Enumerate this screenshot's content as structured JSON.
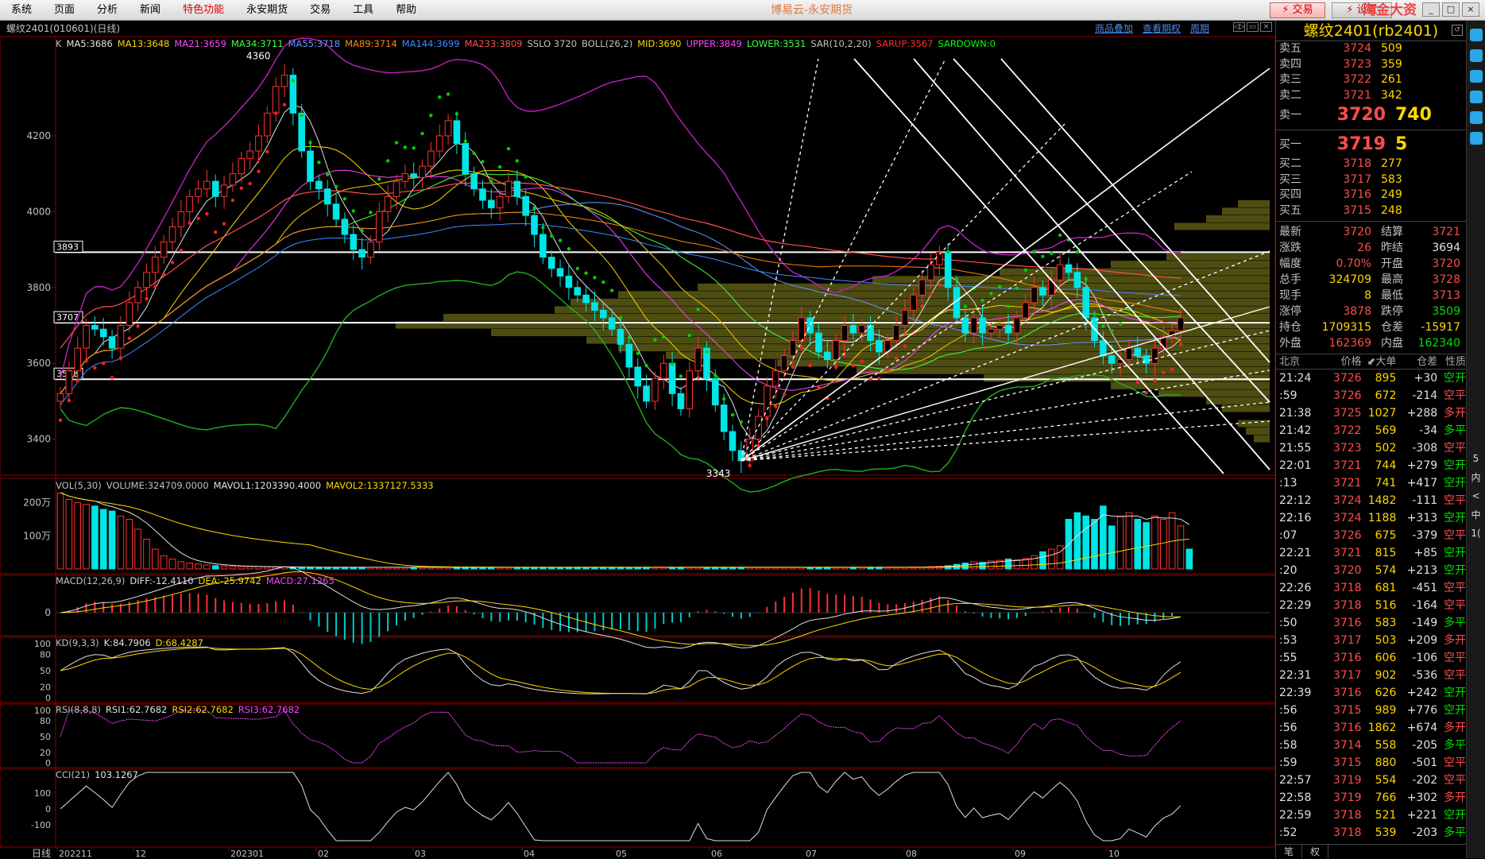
{
  "menu": [
    "系统",
    "页面",
    "分析",
    "新闻",
    "特色功能",
    "永安期货",
    "交易",
    "工具",
    "帮助"
  ],
  "menu_active": "特色功能",
  "app_title": "博易云-永安期货",
  "trade_button": "⚡ 交易",
  "trade_button2": "⚡ 设置",
  "watermark": "淘金大资5etz.com",
  "win_controls": [
    "_",
    "□",
    "×"
  ],
  "chart_header": {
    "symbol": "螺纹2401(010601)(日线)",
    "links": [
      "商品叠加",
      "查看期权",
      "周期"
    ],
    "icons": [
      "◁▷",
      "▭",
      "×"
    ]
  },
  "main_legend": [
    {
      "text": "K",
      "color": "#c0c0c0"
    },
    {
      "text": "MA5:3686",
      "color": "#e0e0e0"
    },
    {
      "text": "MA13:3648",
      "color": "#ffd700"
    },
    {
      "text": "MA21:3659",
      "color": "#ff44ff"
    },
    {
      "text": "MA34:3711",
      "color": "#44ff44"
    },
    {
      "text": "MA55:3718",
      "color": "#6699ff"
    },
    {
      "text": "MA89:3714",
      "color": "#ff8800"
    },
    {
      "text": "MA144:3699",
      "color": "#4488ff"
    },
    {
      "text": "MA233:3809",
      "color": "#ff5050"
    },
    {
      "text": "SSLO 3720",
      "color": "#c0c0c0"
    },
    {
      "text": "BOLL(26,2)",
      "color": "#c0c0c0"
    },
    {
      "text": "MID:3690",
      "color": "#ffd700"
    },
    {
      "text": "UPPER:3849",
      "color": "#ff44ff"
    },
    {
      "text": "LOWER:3531",
      "color": "#44ff44"
    },
    {
      "text": "SAR(10,2,20)",
      "color": "#c0c0c0"
    },
    {
      "text": "SARUP:3567",
      "color": "#ff3030"
    },
    {
      "text": "SARDOWN:0",
      "color": "#00ff00"
    }
  ],
  "vol_legend": [
    {
      "text": "VOL(5,30)",
      "color": "#c0c0c0"
    },
    {
      "text": "VOLUME:324709.0000",
      "color": "#c0c0c0"
    },
    {
      "text": "MAVOL1:1203390.4000",
      "color": "#e0e0e0"
    },
    {
      "text": "MAVOL2:1337127.5333",
      "color": "#ffd700"
    }
  ],
  "macd_legend": [
    {
      "text": "MACD(12,26,9)",
      "color": "#c0c0c0"
    },
    {
      "text": "DIFF:-12.4110",
      "color": "#e0e0e0"
    },
    {
      "text": "DEA:-25.9742",
      "color": "#ffd700"
    },
    {
      "text": "MACD:27.1265",
      "color": "#ff44ff"
    }
  ],
  "kd_legend": [
    {
      "text": "KD(9,3,3)",
      "color": "#c0c0c0"
    },
    {
      "text": "K:84.7906",
      "color": "#e0e0e0"
    },
    {
      "text": "D:68.4287",
      "color": "#ffd700"
    }
  ],
  "rsi_legend": [
    {
      "text": "RSI(8,8,8)",
      "color": "#c0c0c0"
    },
    {
      "text": "RSI1:62.7682",
      "color": "#e0e0e0"
    },
    {
      "text": "RSI2:62.7682",
      "color": "#ffd700"
    },
    {
      "text": "RSI3:62.7682",
      "color": "#ff44ff"
    }
  ],
  "cci_legend": [
    {
      "text": "CCI(21)",
      "color": "#c0c0c0"
    },
    {
      "text": "103.1267",
      "color": "#e0e0e0"
    }
  ],
  "chart_data": {
    "type": "candlestick",
    "period": "日线",
    "price_axis": {
      "ticks": [
        3400,
        3600,
        3800,
        4000,
        4200
      ],
      "range": [
        3330,
        4420
      ]
    },
    "vol_axis": {
      "ticks": [
        "200万",
        "100万"
      ]
    },
    "macd_axis": {
      "ticks": [
        "0"
      ]
    },
    "kd_axis": {
      "ticks": [
        "100",
        "80",
        "50",
        "20",
        "0"
      ]
    },
    "rsi_axis": {
      "ticks": [
        "100",
        "80",
        "50",
        "20",
        "0"
      ]
    },
    "cci_axis": {
      "ticks": [
        "100",
        "0",
        "-100"
      ]
    },
    "date_axis": {
      "label": "日线",
      "ticks": [
        "202211",
        "12",
        "202301",
        "02",
        "03",
        "04",
        "05",
        "06",
        "07",
        "08",
        "09",
        "10"
      ]
    },
    "annotations": {
      "high": "4360",
      "low": "3343"
    },
    "horizontal_levels": [
      {
        "price": 3893,
        "label": "3893"
      },
      {
        "price": 3707,
        "label": "3707"
      },
      {
        "price": 3558,
        "label": "3558"
      }
    ],
    "close_series": [
      3520,
      3580,
      3640,
      3700,
      3690,
      3670,
      3640,
      3700,
      3760,
      3800,
      3840,
      3880,
      3920,
      3960,
      4000,
      4040,
      4060,
      4080,
      4040,
      4070,
      4100,
      4140,
      4160,
      4200,
      4260,
      4330,
      4360,
      4260,
      4160,
      4080,
      4060,
      4020,
      3980,
      3940,
      3900,
      3880,
      3920,
      4000,
      4040,
      4080,
      4100,
      4090,
      4120,
      4160,
      4200,
      4240,
      4180,
      4100,
      4060,
      4030,
      4010,
      4040,
      4080,
      4040,
      3990,
      3940,
      3880,
      3850,
      3830,
      3800,
      3780,
      3760,
      3740,
      3720,
      3690,
      3650,
      3590,
      3540,
      3500,
      3560,
      3600,
      3520,
      3480,
      3580,
      3640,
      3560,
      3490,
      3420,
      3370,
      3343,
      3400,
      3460,
      3540,
      3580,
      3620,
      3660,
      3720,
      3680,
      3630,
      3610,
      3660,
      3700,
      3680,
      3700,
      3660,
      3630,
      3660,
      3700,
      3740,
      3780,
      3820,
      3860,
      3893,
      3800,
      3720,
      3680,
      3720,
      3680,
      3690,
      3700,
      3680,
      3720,
      3760,
      3800,
      3780,
      3820,
      3860,
      3840,
      3800,
      3720,
      3660,
      3620,
      3600,
      3610,
      3640,
      3620,
      3600,
      3640,
      3670,
      3686,
      3720
    ],
    "volume_series": [
      230,
      210,
      200,
      195,
      190,
      180,
      175,
      160,
      150,
      120,
      90,
      60,
      40,
      30,
      22,
      18,
      15,
      12,
      10,
      9,
      8,
      8,
      7,
      7,
      6,
      6,
      6,
      6,
      5,
      5,
      5,
      5,
      5,
      5,
      5,
      5,
      5,
      5,
      5,
      5,
      5,
      5,
      5,
      5,
      5,
      5,
      5,
      5,
      5,
      5,
      5,
      5,
      5,
      5,
      5,
      5,
      5,
      5,
      5,
      5,
      5,
      5,
      5,
      5,
      5,
      5,
      5,
      5,
      5,
      5,
      5,
      5,
      5,
      5,
      5,
      5,
      5,
      5,
      5,
      5,
      5,
      5,
      5,
      5,
      5,
      5,
      5,
      5,
      5,
      5,
      5,
      5,
      5,
      5,
      5,
      5,
      5,
      5,
      5,
      6,
      6,
      7,
      8,
      10,
      14,
      18,
      22,
      20,
      24,
      26,
      30,
      28,
      32,
      40,
      52,
      60,
      70,
      150,
      170,
      160,
      150,
      190,
      130,
      160,
      170,
      150,
      140,
      160,
      150,
      170,
      130,
      60
    ]
  },
  "quote": {
    "title": "螺纹2401(rb2401)",
    "asks": [
      {
        "label": "卖五",
        "price": "3724",
        "vol": "509"
      },
      {
        "label": "卖四",
        "price": "3723",
        "vol": "359"
      },
      {
        "label": "卖三",
        "price": "3722",
        "vol": "261"
      },
      {
        "label": "卖二",
        "price": "3721",
        "vol": "342"
      },
      {
        "label": "卖一",
        "price": "3720",
        "vol": "740"
      }
    ],
    "bids": [
      {
        "label": "买一",
        "price": "3719",
        "vol": "5"
      },
      {
        "label": "买二",
        "price": "3718",
        "vol": "277"
      },
      {
        "label": "买三",
        "price": "3717",
        "vol": "583"
      },
      {
        "label": "买四",
        "price": "3716",
        "vol": "249"
      },
      {
        "label": "买五",
        "price": "3715",
        "vol": "248"
      }
    ],
    "stats": [
      {
        "l": "最新",
        "v": "3720",
        "vc": "red",
        "l2": "结算",
        "v2": "3721",
        "v2c": "red"
      },
      {
        "l": "涨跌",
        "v": "26",
        "vc": "red",
        "l2": "昨结",
        "v2": "3694",
        "v2c": "white"
      },
      {
        "l": "幅度",
        "v": "0.70%",
        "vc": "red",
        "l2": "开盘",
        "v2": "3720",
        "v2c": "red"
      },
      {
        "l": "总手",
        "v": "324709",
        "vc": "yellow",
        "l2": "最高",
        "v2": "3728",
        "v2c": "red"
      },
      {
        "l": "现手",
        "v": "8",
        "vc": "yellow",
        "l2": "最低",
        "v2": "3713",
        "v2c": "red"
      },
      {
        "l": "涨停",
        "v": "3878",
        "vc": "red",
        "l2": "跌停",
        "v2": "3509",
        "v2c": "green"
      },
      {
        "l": "持仓",
        "v": "1709315",
        "vc": "yellow",
        "l2": "仓差",
        "v2": "-15917",
        "v2c": "yellow"
      },
      {
        "l": "外盘",
        "v": "162369",
        "vc": "red",
        "l2": "内盘",
        "v2": "162340",
        "v2c": "green"
      }
    ],
    "tick_header": [
      "北京",
      "价格",
      "⬋大单",
      "仓差",
      "性质"
    ],
    "ticks": [
      {
        "t": "21:24",
        "p": "3726",
        "v": "895",
        "oi": "+30",
        "oic": "white",
        "n": "空开",
        "nc": "green"
      },
      {
        "t": ":59",
        "p": "3726",
        "v": "672",
        "oi": "-214",
        "oic": "white",
        "n": "空平",
        "nc": "red"
      },
      {
        "t": "21:38",
        "p": "3725",
        "v": "1027",
        "oi": "+288",
        "oic": "white",
        "n": "多开",
        "nc": "red"
      },
      {
        "t": "21:42",
        "p": "3722",
        "v": "569",
        "oi": "-34",
        "oic": "white",
        "n": "多平",
        "nc": "green"
      },
      {
        "t": "21:55",
        "p": "3723",
        "v": "502",
        "oi": "-308",
        "oic": "white",
        "n": "空平",
        "nc": "red"
      },
      {
        "t": "22:01",
        "p": "3721",
        "v": "744",
        "oi": "+279",
        "oic": "white",
        "n": "空开",
        "nc": "green"
      },
      {
        "t": ":13",
        "p": "3721",
        "v": "741",
        "oi": "+417",
        "oic": "white",
        "n": "空开",
        "nc": "green"
      },
      {
        "t": "22:12",
        "p": "3724",
        "v": "1482",
        "oi": "-111",
        "oic": "white",
        "n": "空平",
        "nc": "red"
      },
      {
        "t": "22:16",
        "p": "3724",
        "v": "1188",
        "oi": "+313",
        "oic": "white",
        "n": "空开",
        "nc": "green"
      },
      {
        "t": ":07",
        "p": "3726",
        "v": "675",
        "oi": "-379",
        "oic": "white",
        "n": "空平",
        "nc": "red"
      },
      {
        "t": "22:21",
        "p": "3721",
        "v": "815",
        "oi": "+85",
        "oic": "white",
        "n": "空开",
        "nc": "green"
      },
      {
        "t": ":20",
        "p": "3720",
        "v": "574",
        "oi": "+213",
        "oic": "white",
        "n": "空开",
        "nc": "green"
      },
      {
        "t": "22:26",
        "p": "3718",
        "v": "681",
        "oi": "-451",
        "oic": "white",
        "n": "空平",
        "nc": "red"
      },
      {
        "t": "22:29",
        "p": "3718",
        "v": "516",
        "oi": "-164",
        "oic": "white",
        "n": "空平",
        "nc": "red"
      },
      {
        "t": ":50",
        "p": "3716",
        "v": "583",
        "oi": "-149",
        "oic": "white",
        "n": "多平",
        "nc": "green"
      },
      {
        "t": ":53",
        "p": "3717",
        "v": "503",
        "oi": "+209",
        "oic": "white",
        "n": "多开",
        "nc": "red"
      },
      {
        "t": ":55",
        "p": "3716",
        "v": "606",
        "oi": "-106",
        "oic": "white",
        "n": "空平",
        "nc": "red"
      },
      {
        "t": "22:31",
        "p": "3717",
        "v": "902",
        "oi": "-536",
        "oic": "white",
        "n": "空平",
        "nc": "red"
      },
      {
        "t": "22:39",
        "p": "3716",
        "v": "626",
        "oi": "+242",
        "oic": "white",
        "n": "空开",
        "nc": "green"
      },
      {
        "t": ":56",
        "p": "3715",
        "v": "989",
        "oi": "+776",
        "oic": "white",
        "n": "空开",
        "nc": "green"
      },
      {
        "t": ":56",
        "p": "3716",
        "v": "1862",
        "oi": "+674",
        "oic": "white",
        "n": "多开",
        "nc": "red"
      },
      {
        "t": ":58",
        "p": "3714",
        "v": "558",
        "oi": "-205",
        "oic": "white",
        "n": "多平",
        "nc": "green"
      },
      {
        "t": ":59",
        "p": "3715",
        "v": "880",
        "oi": "-501",
        "oic": "white",
        "n": "空平",
        "nc": "red"
      },
      {
        "t": "22:57",
        "p": "3719",
        "v": "554",
        "oi": "-202",
        "oic": "white",
        "n": "空平",
        "nc": "red"
      },
      {
        "t": "22:58",
        "p": "3719",
        "v": "766",
        "oi": "+302",
        "oic": "white",
        "n": "多开",
        "nc": "red"
      },
      {
        "t": "22:59",
        "p": "3718",
        "v": "521",
        "oi": "+221",
        "oic": "white",
        "n": "空开",
        "nc": "green"
      },
      {
        "t": ":52",
        "p": "3718",
        "v": "539",
        "oi": "-203",
        "oic": "white",
        "n": "多平",
        "nc": "green"
      }
    ],
    "footer": [
      "笔",
      "权"
    ]
  },
  "side_strip": [
    "5",
    "内",
    "<",
    "中",
    "1("
  ]
}
